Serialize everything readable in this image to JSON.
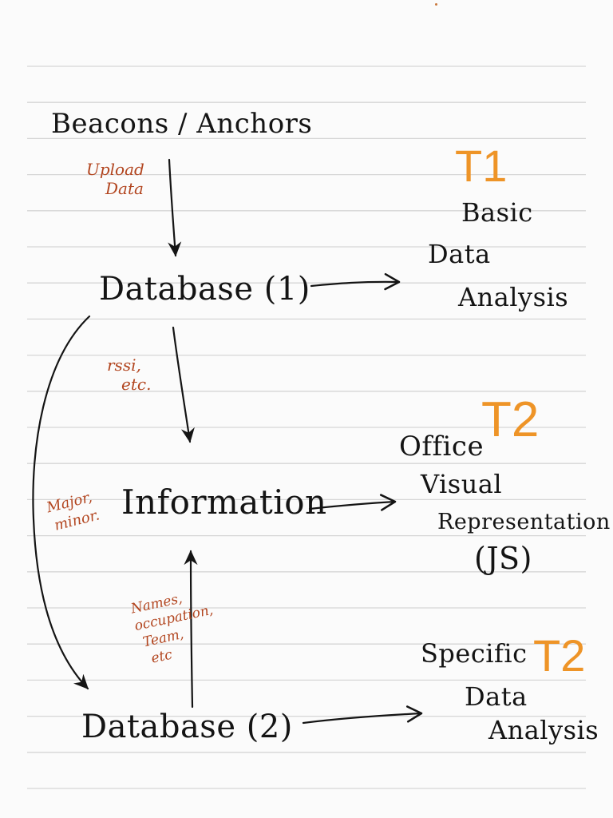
{
  "colors": {
    "paper": "#fbfbfb",
    "rule": "#d6d6d6",
    "ink": "#141414",
    "note": "#b2451f",
    "tag": "#ee9427"
  },
  "nodes": {
    "beacons": "Beacons / Anchors",
    "db1": "Database (1)",
    "information": "Information",
    "db2": "Database (2)"
  },
  "outputs": {
    "t1": [
      "Basic",
      "Data",
      "Analysis"
    ],
    "t2_office": [
      "Office",
      "Visual",
      "Representation",
      "(JS)"
    ],
    "t2_specific": [
      "Specific",
      "Data",
      "Analysis"
    ]
  },
  "tags": {
    "t1": "T1",
    "t2a": "T2",
    "t2b": "T2"
  },
  "edge_labels": {
    "upload": [
      "Upload",
      "Data"
    ],
    "rssi": [
      "rssi,",
      "etc."
    ],
    "major_minor": [
      "Major,",
      "minor."
    ],
    "names": [
      "Names,",
      "occupation,",
      "Team,",
      "etc"
    ]
  }
}
